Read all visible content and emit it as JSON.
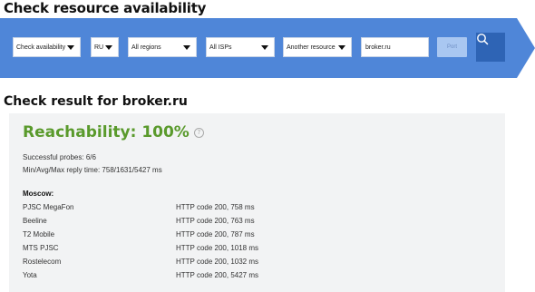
{
  "page_title": "Check resource availability",
  "toolbar": {
    "check_type": "Check availability",
    "country": "RU",
    "region": "All regions",
    "isp": "All ISPs",
    "resource": "Another resource",
    "host_value": "broker.ru",
    "port_placeholder": "Port",
    "search_icon": "search-icon",
    "bg_color": "#4f86d8",
    "button_color": "#2e64b5"
  },
  "result": {
    "title": "Check result for broker.ru",
    "reachability": "Reachability: 100%",
    "help_glyph": "?",
    "successful_probes": "Successful probes: 6/6",
    "reply_time": "Min/Avg/Max reply time: 758/1631/5427 ms",
    "region_label": "Moscow:",
    "rows": [
      {
        "isp": "PJSC MegaFon",
        "result": "HTTP code 200, 758 ms"
      },
      {
        "isp": "Beeline",
        "result": "HTTP code 200, 763 ms"
      },
      {
        "isp": "T2 Mobile",
        "result": "HTTP code 200, 787 ms"
      },
      {
        "isp": "MTS PJSC",
        "result": "HTTP code 200, 1018 ms"
      },
      {
        "isp": "Rostelecom",
        "result": "HTTP code 200, 1032 ms"
      },
      {
        "isp": "Yota",
        "result": "HTTP code 200, 5427 ms"
      }
    ],
    "success_color": "#5a9a2c"
  }
}
